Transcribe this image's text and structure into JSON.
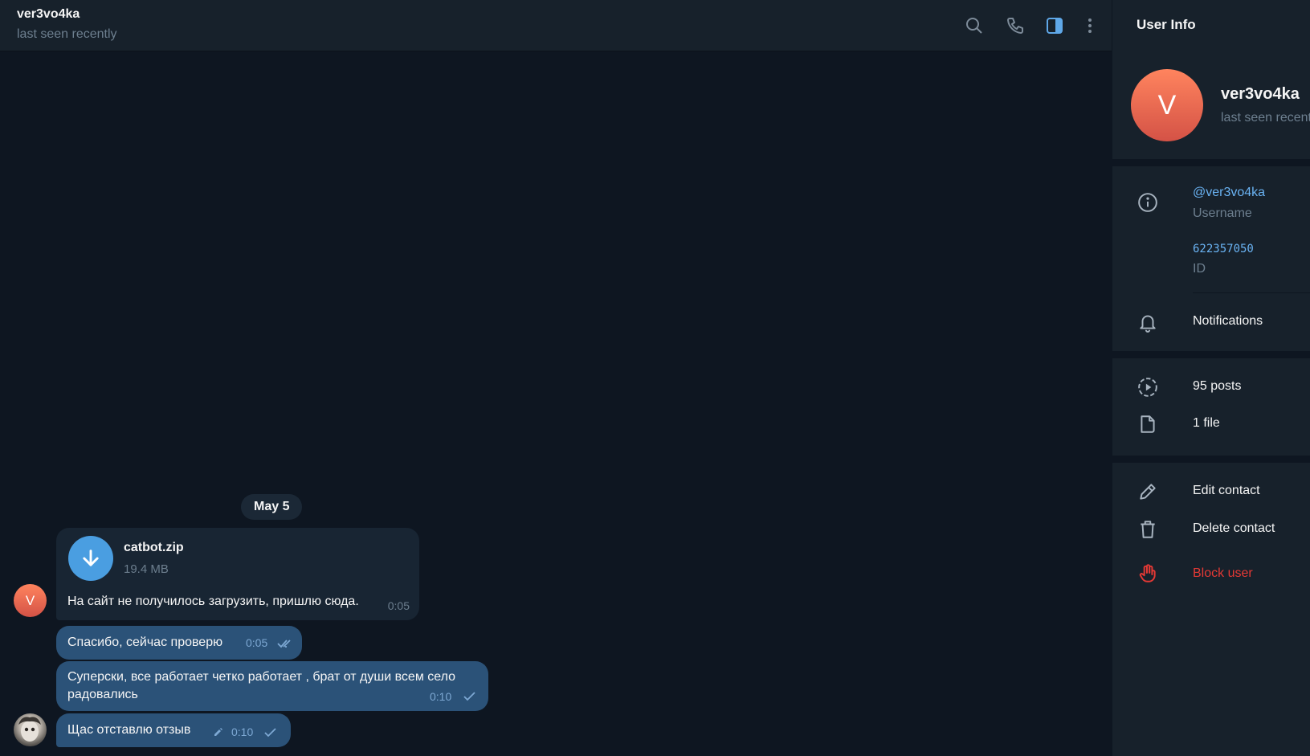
{
  "header": {
    "title": "ver3vo4ka",
    "status": "last seen recently",
    "icons": [
      "search-icon",
      "phone-icon",
      "sidebar-toggle-icon",
      "more-vertical-icon"
    ]
  },
  "messages": {
    "date_chip": "May 5",
    "file_message": {
      "avatar_letter": "V",
      "file_name": "catbot.zip",
      "file_size": "19.4 MB",
      "text": "На сайт не получилось загрузить, пришлю сюда.",
      "time": "0:05"
    },
    "outgoing": [
      {
        "text": "Спасибо, сейчас проверю",
        "time": "0:05",
        "status": "read"
      },
      {
        "text_line1": "Суперски, все работает четко работает , брат от души всем село",
        "text_line2": "радовались",
        "time": "0:10",
        "status": "sent"
      },
      {
        "text": "Щас отставлю отзыв",
        "time": "0:10",
        "status": "sent",
        "edited": true
      }
    ]
  },
  "panel": {
    "title": "User Info",
    "avatar_letter": "V",
    "name": "ver3vo4ka",
    "status": "last seen recently",
    "username": "@ver3vo4ka",
    "username_label": "Username",
    "id_value": "622357050",
    "id_label": "ID",
    "notifications_label": "Notifications",
    "posts_label": "95 posts",
    "files_label": "1 file",
    "edit_contact_label": "Edit contact",
    "delete_contact_label": "Delete contact",
    "block_user_label": "Block user"
  },
  "colors": {
    "chat_bg": "#0e1621",
    "panel_bg": "#17212b",
    "bubble_in": "#182533",
    "bubble_out": "#2b5278",
    "accent": "#6ab3f3",
    "danger": "#e53935",
    "avatar_gradient": [
      "#ff845e",
      "#d45246"
    ]
  }
}
